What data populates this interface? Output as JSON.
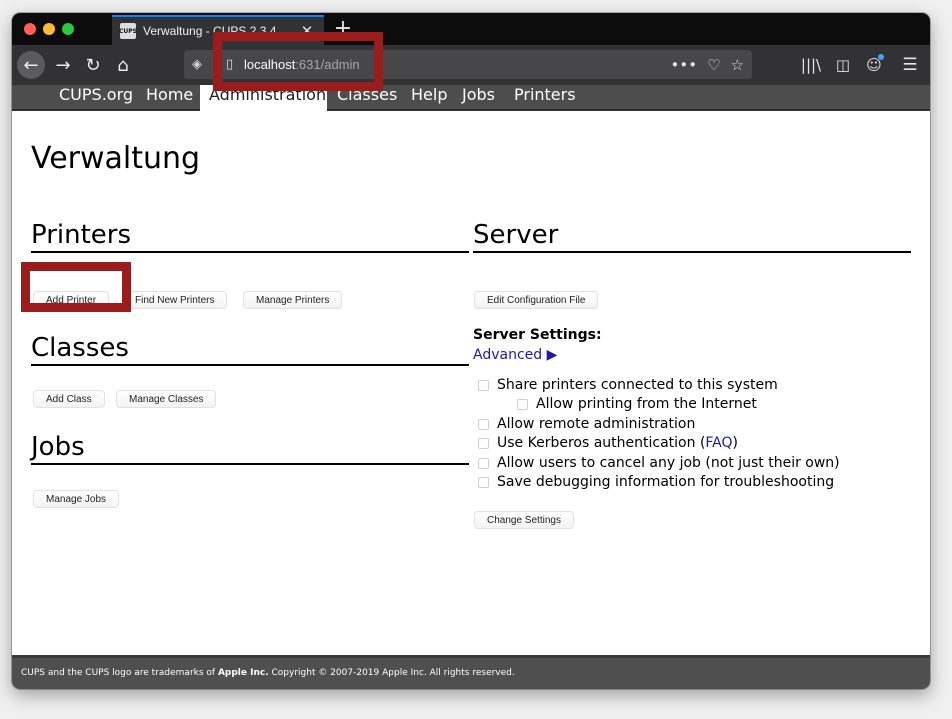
{
  "browser": {
    "tab_title": "Verwaltung - CUPS 2.3.4",
    "tab_favicon_text": "CUPS",
    "tab_close": "✕",
    "new_tab": "+",
    "url_host": "localhost",
    "url_rest": ":631/admin",
    "icons": {
      "back": "←",
      "forward": "→",
      "reload": "↻",
      "home": "⌂",
      "shield": "◈",
      "page": "▯",
      "more": "•••",
      "pocket": "♡",
      "star": "☆",
      "library": "|||\\",
      "sidebar": "◫",
      "account": "☺",
      "menu": "☰"
    }
  },
  "nav": {
    "items": [
      "CUPS.org",
      "Home",
      "Administration",
      "Classes",
      "Help",
      "Jobs",
      "Printers"
    ],
    "active": "Administration"
  },
  "page": {
    "title": "Verwaltung",
    "printers": {
      "heading": "Printers",
      "buttons": [
        "Add Printer",
        "Find New Printers",
        "Manage Printers"
      ]
    },
    "classes": {
      "heading": "Classes",
      "buttons": [
        "Add Class",
        "Manage Classes"
      ]
    },
    "jobs": {
      "heading": "Jobs",
      "buttons": [
        "Manage Jobs"
      ]
    },
    "server": {
      "heading": "Server",
      "edit_config_button": "Edit Configuration File",
      "settings_label": "Server Settings:",
      "advanced_link": "Advanced ▶",
      "options": {
        "share_printers": "Share printers connected to this system",
        "allow_internet": "Allow printing from the Internet",
        "remote_admin": "Allow remote administration",
        "kerberos_prefix": "Use Kerberos authentication (",
        "kerberos_link": "FAQ",
        "kerberos_suffix": ")",
        "cancel_any": "Allow users to cancel any job (not just their own)",
        "debug_logging": "Save debugging information for troubleshooting"
      },
      "change_settings_button": "Change Settings"
    }
  },
  "footer": {
    "prefix": "CUPS and the CUPS logo are trademarks of ",
    "company": "Apple Inc.",
    "suffix": " Copyright © 2007-2019 Apple Inc. All rights reserved."
  },
  "colors": {
    "highlight": "#9b1c1c",
    "link": "#1a1aa6",
    "nav_bg": "#4d4d4d",
    "footer_bg": "#4f4f4f"
  }
}
